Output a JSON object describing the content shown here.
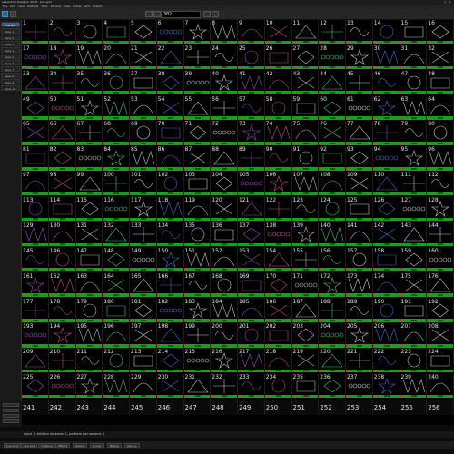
{
  "window": {
    "title": "Lasershow Designer 2018 - Cue grid",
    "controls": "– □ ×"
  },
  "menu": [
    "File",
    "Edit",
    "View",
    "Settings",
    "Tools",
    "Window",
    "Help",
    "Extras",
    "Grid",
    "Output"
  ],
  "toolbar": {
    "display_value": "302",
    "spinner_color": "#2f5f8f"
  },
  "sidebar": {
    "items": [
      "Cue List",
      "Page 1",
      "Page 2",
      "Page 3",
      "Page 4",
      "Page 5",
      "Page 6",
      "Page 7",
      "Page 8",
      "Page 9",
      "Page 10"
    ],
    "selected_index": 0
  },
  "grid": {
    "first_cue": 1,
    "columns": 16,
    "rows": 15,
    "bar_color": "#19a01a"
  },
  "last_row": {
    "first_cue": 241,
    "count": 16
  },
  "status": {
    "text": "input 1, brilliant antenna: 1, perform per second: 0"
  },
  "bottom_tabs": [
    "Live Grid",
    "Cue List",
    "Timeline",
    "Effects",
    "Output",
    "Zones",
    "Beams",
    "Library"
  ]
}
